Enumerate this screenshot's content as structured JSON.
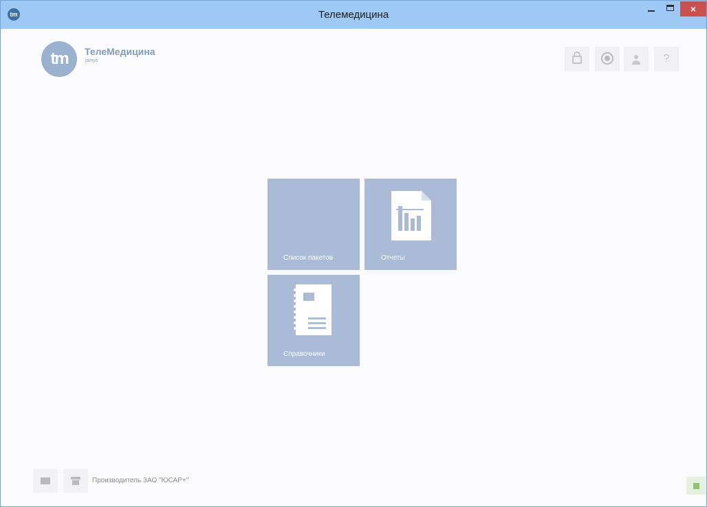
{
  "window": {
    "title": "Телемедицина",
    "icon_text": "tm",
    "controls": {
      "minimize": "minimize-icon",
      "maximize": "maximize-icon",
      "close_label": "×"
    }
  },
  "header": {
    "logo_text": "tm",
    "brand_name": "ТелеМедицина",
    "brand_sub": "jamys",
    "toolbar": [
      {
        "id": "lock",
        "icon": "lock-icon"
      },
      {
        "id": "settings",
        "icon": "gear-icon"
      },
      {
        "id": "user",
        "icon": "user-icon"
      },
      {
        "id": "help",
        "icon": "help-icon",
        "label": "?"
      }
    ]
  },
  "tiles": [
    {
      "id": "packets",
      "label": "Список пакетов"
    },
    {
      "id": "reports",
      "label": "Отчеты",
      "icon": "report-chart-icon"
    },
    {
      "id": "refs",
      "label": "Справочники",
      "icon": "notebook-icon"
    }
  ],
  "footer": {
    "mail_icon": "mail-icon",
    "phone_icon": "phone-icon",
    "manufacturer": "Производитель ЗАО \"ЮСАР+\"",
    "status_icon": "status-indicator-icon",
    "status_color": "#8ec46b"
  },
  "colors": {
    "titlebar": "#9ec9f4",
    "tile": "#a9bbd6",
    "close_button": "#c9504b",
    "brand": "#7e9bbd"
  }
}
